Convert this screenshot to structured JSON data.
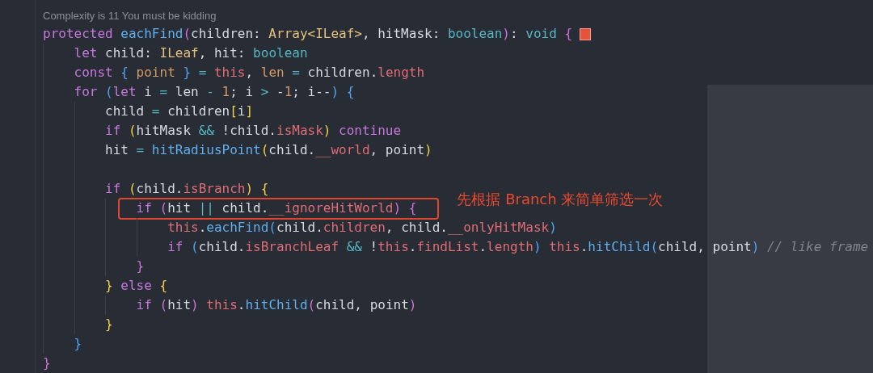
{
  "codelens": "Complexity is 11 You must be kidding",
  "lines": [
    {
      "kind": "code",
      "marker": true,
      "tokens": [
        {
          "text": "protected ",
          "kind": "keyword"
        },
        {
          "text": "eachFind",
          "kind": "function"
        },
        {
          "text": "(",
          "kind": "bracket2"
        },
        {
          "text": "children: ",
          "kind": "text"
        },
        {
          "text": "Array<ILeaf>",
          "kind": "type"
        },
        {
          "text": ", hitMask: ",
          "kind": "text"
        },
        {
          "text": "boolean",
          "kind": "operator"
        },
        {
          "text": ")",
          "kind": "bracket2"
        },
        {
          "text": ": ",
          "kind": "text"
        },
        {
          "text": "void ",
          "kind": "operator"
        },
        {
          "text": "{",
          "kind": "bracket2"
        }
      ],
      "children": [
        {
          "kind": "code",
          "tokens": [
            {
              "text": "let ",
              "kind": "keyword"
            },
            {
              "text": "child: ",
              "kind": "text"
            },
            {
              "text": "ILeaf",
              "kind": "type"
            },
            {
              "text": ", hit: ",
              "kind": "text"
            },
            {
              "text": "boolean",
              "kind": "operator"
            }
          ]
        },
        {
          "kind": "code",
          "tokens": [
            {
              "text": "const ",
              "kind": "keyword"
            },
            {
              "text": "{",
              "kind": "bracket3"
            },
            {
              "text": " point ",
              "kind": "variable"
            },
            {
              "text": "}",
              "kind": "bracket3"
            },
            {
              "text": " = ",
              "kind": "operator"
            },
            {
              "text": "this",
              "kind": "property"
            },
            {
              "text": ", ",
              "kind": "text"
            },
            {
              "text": "len",
              "kind": "variable"
            },
            {
              "text": " = ",
              "kind": "operator"
            },
            {
              "text": "children.",
              "kind": "text"
            },
            {
              "text": "length",
              "kind": "property"
            }
          ]
        },
        {
          "kind": "code",
          "tokens": [
            {
              "text": "for ",
              "kind": "keyword"
            },
            {
              "text": "(",
              "kind": "bracket3"
            },
            {
              "text": "let",
              "kind": "keyword"
            },
            {
              "text": " i ",
              "kind": "text"
            },
            {
              "text": "=",
              "kind": "operator"
            },
            {
              "text": " len ",
              "kind": "text"
            },
            {
              "text": "- ",
              "kind": "operator"
            },
            {
              "text": "1",
              "kind": "number"
            },
            {
              "text": "; i ",
              "kind": "text"
            },
            {
              "text": ">",
              "kind": "operator"
            },
            {
              "text": " -",
              "kind": "text"
            },
            {
              "text": "1",
              "kind": "number"
            },
            {
              "text": "; i--",
              "kind": "text"
            },
            {
              "text": ")",
              "kind": "bracket3"
            },
            {
              "text": " {",
              "kind": "bracket3"
            }
          ],
          "children": [
            {
              "kind": "code",
              "tokens": [
                {
                  "text": "child ",
                  "kind": "text"
                },
                {
                  "text": "=",
                  "kind": "operator"
                },
                {
                  "text": " children",
                  "kind": "text"
                },
                {
                  "text": "[",
                  "kind": "bracket1"
                },
                {
                  "text": "i",
                  "kind": "text"
                },
                {
                  "text": "]",
                  "kind": "bracket1"
                }
              ]
            },
            {
              "kind": "code",
              "tokens": [
                {
                  "text": "if ",
                  "kind": "keyword"
                },
                {
                  "text": "(",
                  "kind": "bracket1"
                },
                {
                  "text": "hitMask ",
                  "kind": "text"
                },
                {
                  "text": "&&",
                  "kind": "operator"
                },
                {
                  "text": " !child.",
                  "kind": "text"
                },
                {
                  "text": "isMask",
                  "kind": "property"
                },
                {
                  "text": ")",
                  "kind": "bracket1"
                },
                {
                  "text": " continue",
                  "kind": "keyword"
                }
              ]
            },
            {
              "kind": "code",
              "tokens": [
                {
                  "text": "hit ",
                  "kind": "text"
                },
                {
                  "text": "= ",
                  "kind": "operator"
                },
                {
                  "text": "hitRadiusPoint",
                  "kind": "function"
                },
                {
                  "text": "(",
                  "kind": "bracket1"
                },
                {
                  "text": "child.",
                  "kind": "text"
                },
                {
                  "text": "__world",
                  "kind": "property"
                },
                {
                  "text": ", point",
                  "kind": "text"
                },
                {
                  "text": ")",
                  "kind": "bracket1"
                }
              ]
            },
            {
              "kind": "blank"
            },
            {
              "kind": "code",
              "tokens": [
                {
                  "text": "if ",
                  "kind": "keyword"
                },
                {
                  "text": "(",
                  "kind": "bracket1"
                },
                {
                  "text": "child.",
                  "kind": "text"
                },
                {
                  "text": "isBranch",
                  "kind": "property"
                },
                {
                  "text": ")",
                  "kind": "bracket1"
                },
                {
                  "text": " {",
                  "kind": "bracket1"
                }
              ],
              "children": [
                {
                  "kind": "code",
                  "highlighted": true,
                  "note": "先根据 Branch 来简单筛选一次",
                  "tokens": [
                    {
                      "text": "if ",
                      "kind": "keyword"
                    },
                    {
                      "text": "(",
                      "kind": "bracket2"
                    },
                    {
                      "text": "hit ",
                      "kind": "text"
                    },
                    {
                      "text": "||",
                      "kind": "operator"
                    },
                    {
                      "text": " child.",
                      "kind": "text"
                    },
                    {
                      "text": "__ignoreHitWorld",
                      "kind": "property"
                    },
                    {
                      "text": ")",
                      "kind": "bracket2"
                    },
                    {
                      "text": " {",
                      "kind": "bracket2"
                    }
                  ],
                  "children": [
                    {
                      "kind": "code",
                      "tokens": [
                        {
                          "text": "this",
                          "kind": "property"
                        },
                        {
                          "text": ".",
                          "kind": "text"
                        },
                        {
                          "text": "eachFind",
                          "kind": "function"
                        },
                        {
                          "text": "(",
                          "kind": "bracket3"
                        },
                        {
                          "text": "child.",
                          "kind": "text"
                        },
                        {
                          "text": "children",
                          "kind": "property"
                        },
                        {
                          "text": ", child.",
                          "kind": "text"
                        },
                        {
                          "text": "__onlyHitMask",
                          "kind": "property"
                        },
                        {
                          "text": ")",
                          "kind": "bracket3"
                        }
                      ]
                    },
                    {
                      "kind": "code",
                      "tokens": [
                        {
                          "text": "if ",
                          "kind": "keyword"
                        },
                        {
                          "text": "(",
                          "kind": "bracket3"
                        },
                        {
                          "text": "child.",
                          "kind": "text"
                        },
                        {
                          "text": "isBranchLeaf ",
                          "kind": "property"
                        },
                        {
                          "text": "&&",
                          "kind": "operator"
                        },
                        {
                          "text": " !",
                          "kind": "text"
                        },
                        {
                          "text": "this",
                          "kind": "property"
                        },
                        {
                          "text": ".",
                          "kind": "text"
                        },
                        {
                          "text": "findList",
                          "kind": "property"
                        },
                        {
                          "text": ".",
                          "kind": "text"
                        },
                        {
                          "text": "length",
                          "kind": "property"
                        },
                        {
                          "text": ")",
                          "kind": "bracket3"
                        },
                        {
                          "text": " this",
                          "kind": "property"
                        },
                        {
                          "text": ".",
                          "kind": "text"
                        },
                        {
                          "text": "hitChild",
                          "kind": "function"
                        },
                        {
                          "text": "(",
                          "kind": "bracket3"
                        },
                        {
                          "text": "child, point",
                          "kind": "text"
                        },
                        {
                          "text": ")",
                          "kind": "bracket3"
                        },
                        {
                          "text": " // like frame",
                          "kind": "comment"
                        }
                      ]
                    }
                  ]
                },
                {
                  "kind": "code",
                  "tokens": [
                    {
                      "text": "}",
                      "kind": "bracket2"
                    }
                  ]
                }
              ]
            },
            {
              "kind": "code",
              "tokens": [
                {
                  "text": "}",
                  "kind": "bracket1"
                },
                {
                  "text": " else ",
                  "kind": "keyword"
                },
                {
                  "text": "{",
                  "kind": "bracket1"
                }
              ],
              "children": [
                {
                  "kind": "code",
                  "tokens": [
                    {
                      "text": "if ",
                      "kind": "keyword"
                    },
                    {
                      "text": "(",
                      "kind": "bracket2"
                    },
                    {
                      "text": "hit",
                      "kind": "text"
                    },
                    {
                      "text": ")",
                      "kind": "bracket2"
                    },
                    {
                      "text": " this",
                      "kind": "property"
                    },
                    {
                      "text": ".",
                      "kind": "text"
                    },
                    {
                      "text": "hitChild",
                      "kind": "function"
                    },
                    {
                      "text": "(",
                      "kind": "bracket2"
                    },
                    {
                      "text": "child, point",
                      "kind": "text"
                    },
                    {
                      "text": ")",
                      "kind": "bracket2"
                    }
                  ]
                }
              ]
            },
            {
              "kind": "code",
              "tokens": [
                {
                  "text": "}",
                  "kind": "bracket1"
                }
              ]
            }
          ]
        },
        {
          "kind": "code",
          "tokens": [
            {
              "text": "}",
              "kind": "bracket3"
            }
          ]
        }
      ]
    },
    {
      "kind": "code",
      "tokens": [
        {
          "text": "}",
          "kind": "bracket2"
        }
      ]
    }
  ]
}
